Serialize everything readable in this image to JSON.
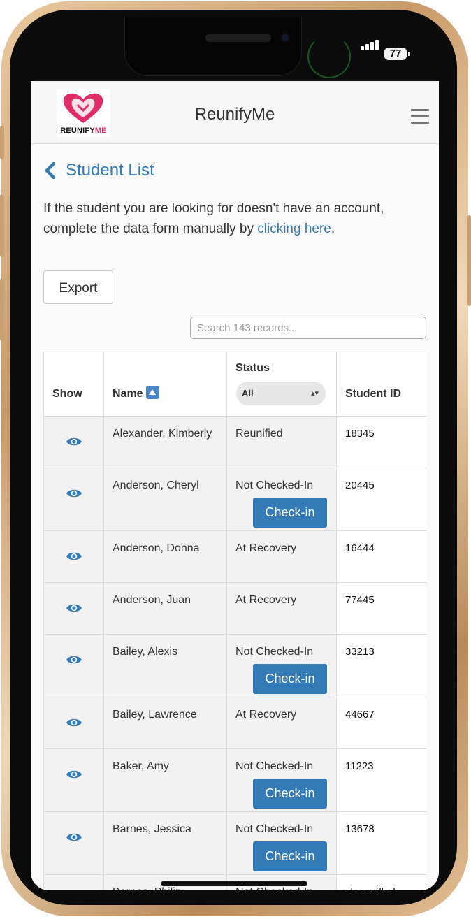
{
  "status_bar": {
    "battery": "77",
    "signal_icon": "cellular-signal-icon"
  },
  "header": {
    "app_title": "ReunifyMe",
    "logo_text_prefix": "REUNIFY",
    "logo_text_suffix": "ME",
    "logo_color": "#e12b66",
    "menu_icon": "hamburger-menu-icon"
  },
  "page": {
    "back_label": "Student List",
    "intro_text": "If the student you are looking for doesn't have an account, complete the data form manually by ",
    "intro_link": "clicking here",
    "intro_end": ".",
    "export_label": "Export",
    "search_placeholder": "Search 143 records..."
  },
  "table": {
    "headers": {
      "show": "Show",
      "name": "Name",
      "status": "Status",
      "status_filter": "All",
      "student_id": "Student ID"
    },
    "checkin_label": "Check-in",
    "rows": [
      {
        "name": "Alexander, Kimberly",
        "status": "Reunified",
        "id": "18345",
        "checkin": false
      },
      {
        "name": "Anderson, Cheryl",
        "status": "Not Checked-In",
        "id": "20445",
        "checkin": true
      },
      {
        "name": "Anderson, Donna",
        "status": "At Recovery",
        "id": "16444",
        "checkin": false
      },
      {
        "name": "Anderson, Juan",
        "status": "At Recovery",
        "id": "77445",
        "checkin": false
      },
      {
        "name": "Bailey, Alexis",
        "status": "Not Checked-In",
        "id": "33213",
        "checkin": true
      },
      {
        "name": "Bailey, Lawrence",
        "status": "At Recovery",
        "id": "44667",
        "checkin": false
      },
      {
        "name": "Baker, Amy",
        "status": "Not Checked-In",
        "id": "11223",
        "checkin": true
      },
      {
        "name": "Barnes, Jessica",
        "status": "Not Checked-In",
        "id": "13678",
        "checkin": true
      },
      {
        "name": "Barnes, Philip",
        "status": "Not Checked-In",
        "id": "sharevilled",
        "checkin": false
      }
    ]
  },
  "colors": {
    "accent": "#337ab7",
    "brand": "#e12b66"
  }
}
